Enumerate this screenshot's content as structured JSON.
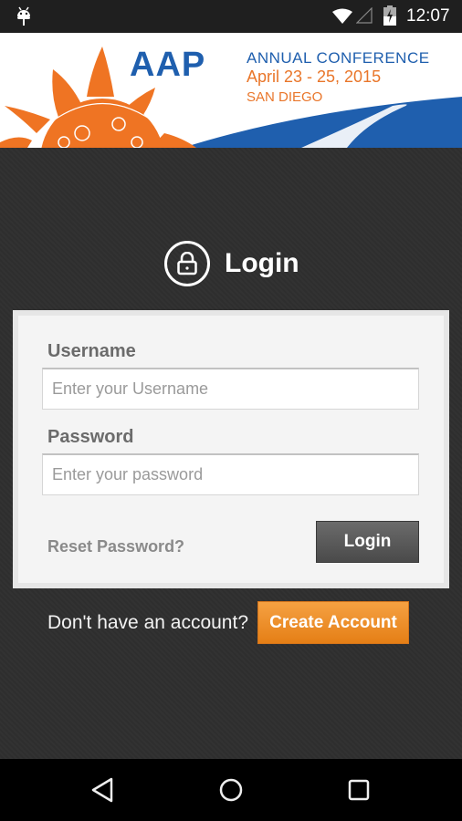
{
  "status_bar": {
    "time": "12:07",
    "icons": [
      "android-debug-icon",
      "wifi-icon",
      "cell-signal-icon",
      "battery-charging-icon"
    ]
  },
  "banner": {
    "brand": "AAP",
    "line1": "ANNUAL CONFERENCE",
    "line2": "April 23 - 25, 2015",
    "line3": "SAN DIEGO",
    "colors": {
      "blue": "#1f5fae",
      "orange": "#e9762a"
    }
  },
  "login": {
    "title": "Login",
    "icon": "lock-icon",
    "username_label": "Username",
    "username_placeholder": "Enter your Username",
    "username_value": "",
    "password_label": "Password",
    "password_placeholder": "Enter your password",
    "password_value": "",
    "reset_link": "Reset Password?",
    "login_button": "Login"
  },
  "signup": {
    "prompt": "Don't have an account?",
    "button": "Create Account",
    "button_color": "#e8841c"
  },
  "nav_bar": {
    "icons": [
      "back-icon",
      "home-icon",
      "recents-icon"
    ]
  }
}
